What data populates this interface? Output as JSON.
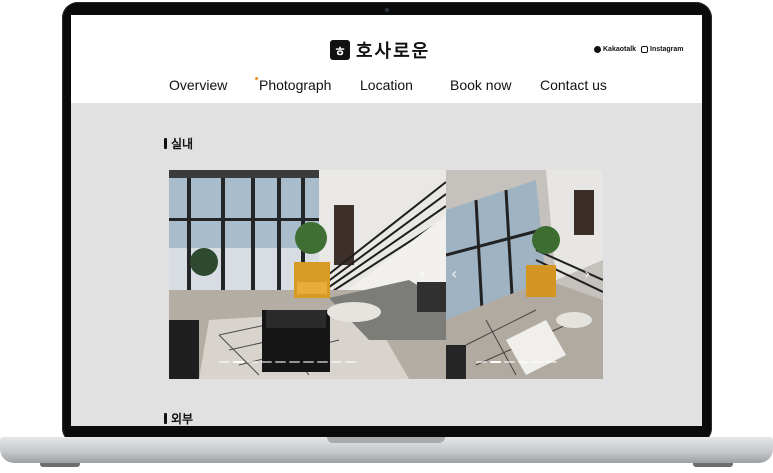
{
  "brand": {
    "logo_mark": "ㅎ",
    "name": "호사로운"
  },
  "social": {
    "kakao": "Kakaotalk",
    "instagram": "Instagram"
  },
  "nav": {
    "items": [
      "Overview",
      "Photograph",
      "Location",
      "Book now",
      "Contact us"
    ],
    "active": "Photograph"
  },
  "sections": {
    "interior": "실내",
    "exterior": "외부"
  },
  "carousel": {
    "total_dots": 10,
    "active_dot": 1,
    "prev_icon": "chevron-left",
    "next_icon": "chevron-right"
  },
  "colors": {
    "accent": "#f08c1e",
    "page_bg": "#e1e1e1",
    "header_bg": "#ffffff",
    "text": "#111111"
  }
}
